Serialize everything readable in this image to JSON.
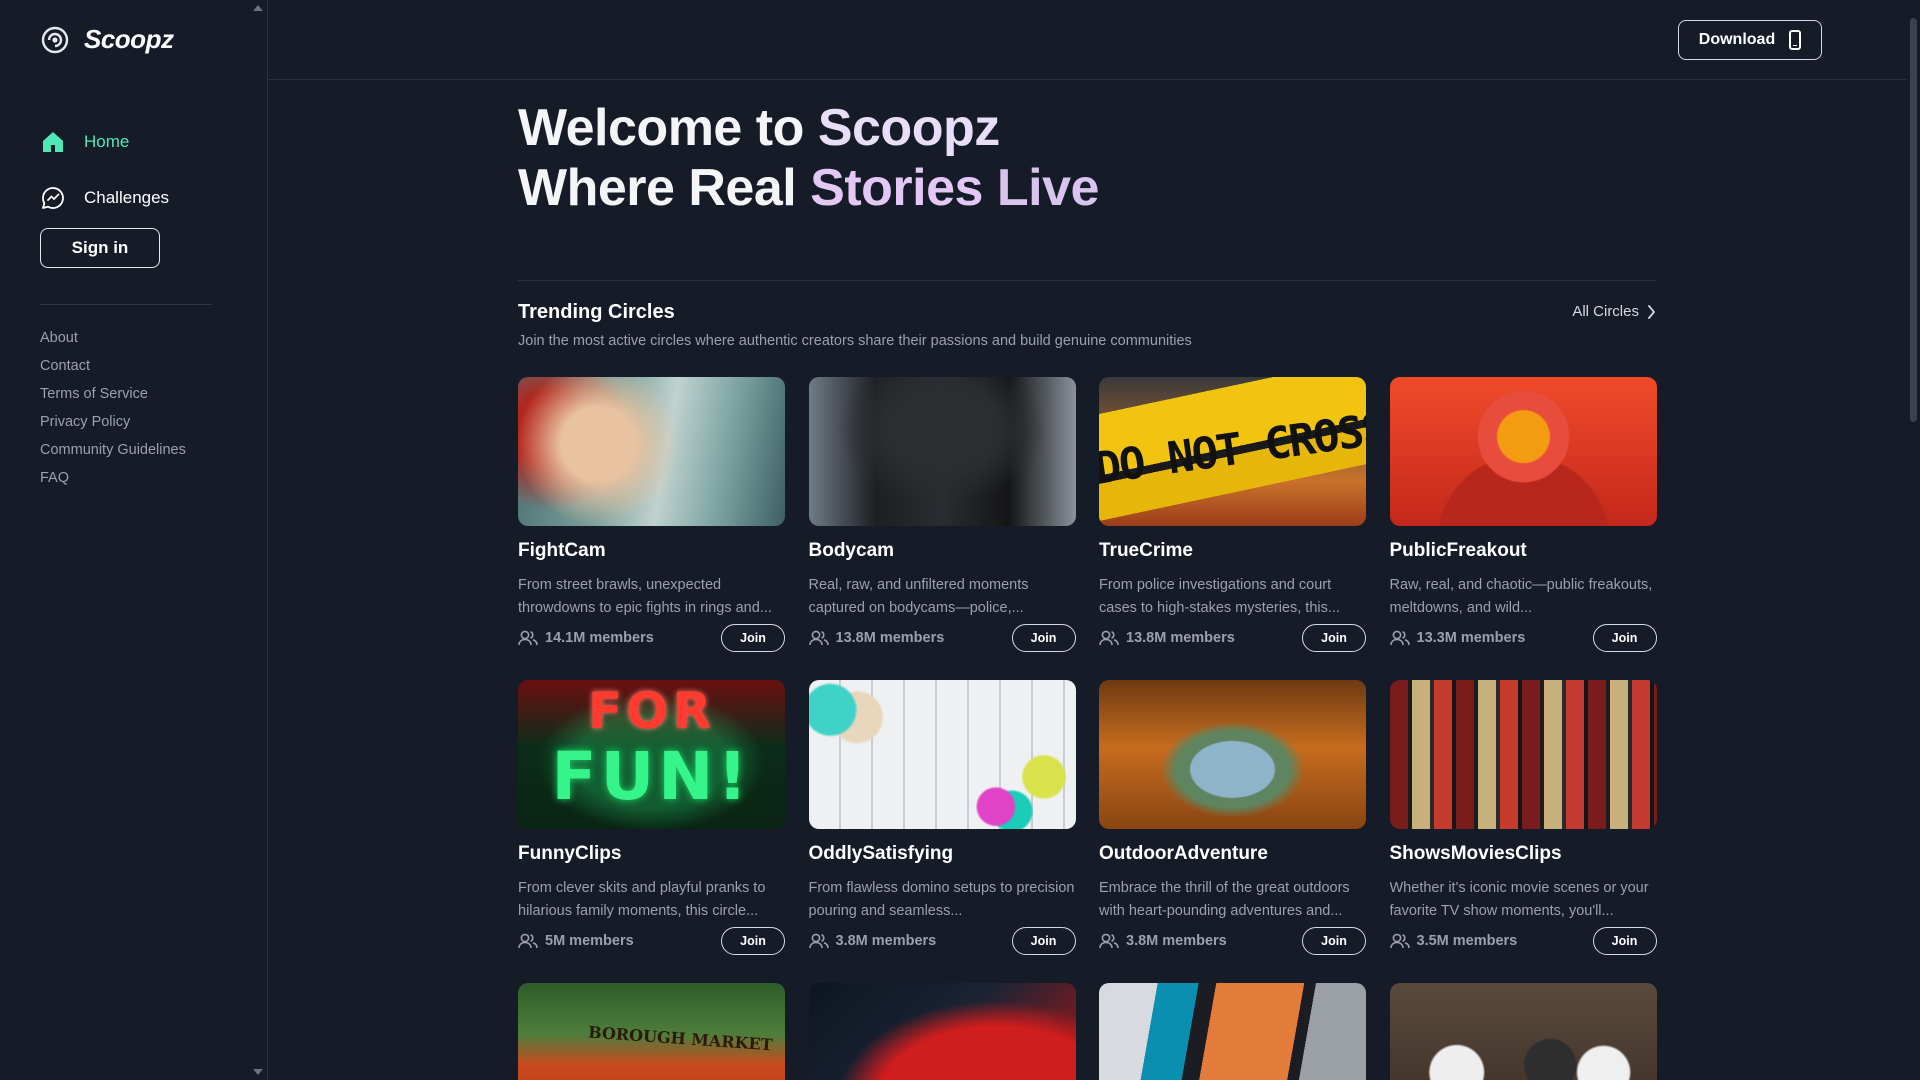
{
  "brand": {
    "name": "Scoopz"
  },
  "sidebar": {
    "nav": [
      {
        "label": "Home",
        "icon": "home-icon",
        "active": true
      },
      {
        "label": "Challenges",
        "icon": "trending-chart-icon",
        "active": false
      }
    ],
    "signin_label": "Sign in",
    "footer_links": [
      "About",
      "Contact",
      "Terms of Service",
      "Privacy Policy",
      "Community Guidelines",
      "FAQ"
    ]
  },
  "topbar": {
    "download_label": "Download"
  },
  "hero": {
    "line1_a": "Welcome to ",
    "line1_b": "Scoopz",
    "line2_a": "Where Real ",
    "line2_b": "Stories ",
    "line2_c": "Live"
  },
  "trending": {
    "title": "Trending Circles",
    "subtitle": "Join the most active circles where authentic creators share their passions and build genuine communities",
    "all_label": "All Circles",
    "join_label": "Join",
    "circles": [
      {
        "name": "FightCam",
        "desc": "From street brawls, unexpected throwdowns to epic fights in rings and...",
        "members": "14.1M members"
      },
      {
        "name": "Bodycam",
        "desc": "Real, raw, and unfiltered moments captured on bodycams—police,...",
        "members": "13.8M members"
      },
      {
        "name": "TrueCrime",
        "desc": "From police investigations and court cases to high-stakes mysteries, this...",
        "members": "13.8M members"
      },
      {
        "name": "PublicFreakout",
        "desc": "Raw, real, and chaotic—public freakouts, meltdowns, and wild...",
        "members": "13.3M members"
      },
      {
        "name": "FunnyClips",
        "desc": "From clever skits and playful pranks to hilarious family moments, this circle...",
        "members": "5M members"
      },
      {
        "name": "OddlySatisfying",
        "desc": "From flawless domino setups to precision pouring and seamless...",
        "members": "3.8M members"
      },
      {
        "name": "OutdoorAdventure",
        "desc": "Embrace the thrill of the great outdoors with heart-pounding adventures and...",
        "members": "3.8M members"
      },
      {
        "name": "ShowsMoviesClips",
        "desc": "Whether it's iconic movie scenes or your favorite TV show moments, you'll...",
        "members": "3.5M members"
      }
    ],
    "thumb_text": {
      "truecrime": "DO NOT CROSS POLI",
      "funny_1": "FOR",
      "funny_2": "FUN!",
      "borough": "BOROUGH MARKET"
    }
  },
  "colors": {
    "background": "#151b27",
    "accent_active": "#4ee8b6",
    "muted_text": "#9aa1ad"
  }
}
